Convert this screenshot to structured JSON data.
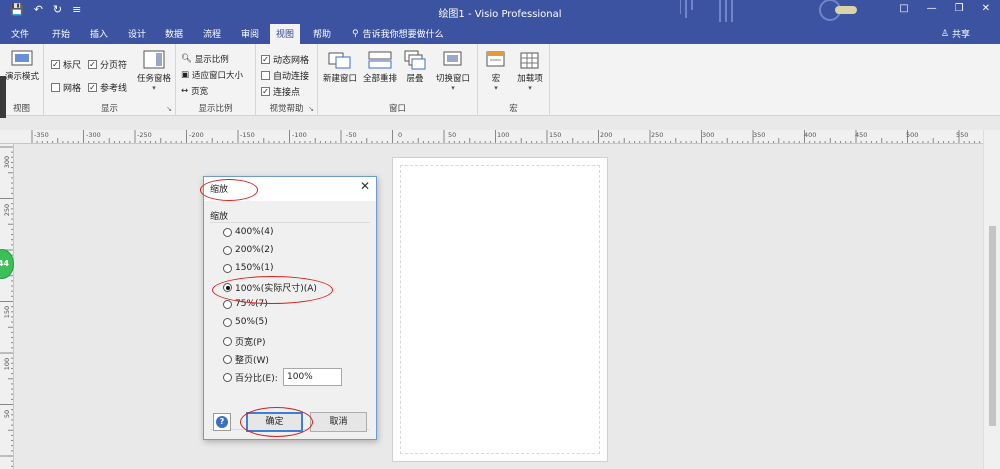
{
  "app": {
    "title": "绘图1 - Visio Professional",
    "menu_tabs": [
      "文件",
      "开始",
      "插入",
      "设计",
      "数据",
      "流程",
      "审阅",
      "视图",
      "帮助"
    ],
    "active_tab": "视图",
    "tell_me": "告诉我你想要做什么",
    "share": "共享"
  },
  "ribbon": {
    "view_group": {
      "button": "演示模式",
      "label": "视图"
    },
    "show_group": {
      "label": "显示",
      "ruler": "标尺",
      "page_breaks": "分页符",
      "grid": "网格",
      "guides": "参考线",
      "task_panes": "任务窗格"
    },
    "zoom_group": {
      "label": "显示比例",
      "zoom": "显示比例",
      "fit_to_window": "适应窗口大小",
      "page_width": "页宽"
    },
    "visual_aids_group": {
      "label": "视觉帮助",
      "dynamic_grid": "动态网格",
      "autoconnect": "自动连接",
      "connection_points": "连接点"
    },
    "window_group": {
      "label": "窗口",
      "new_window": "新建窗口",
      "arrange_all": "全部重排",
      "cascade": "层叠",
      "switch_windows": "切换窗口"
    },
    "macros_group": {
      "label": "宏",
      "macros": "宏",
      "addins": "加载项"
    }
  },
  "rulers": {
    "horizontal": [
      "-350",
      "-300",
      "-250",
      "-200",
      "-150",
      "-100",
      "-50",
      "0",
      "50",
      "100",
      "150",
      "200",
      "250",
      "300",
      "350",
      "400",
      "450",
      "500",
      "550"
    ],
    "vertical": [
      "300",
      "250",
      "200",
      "150",
      "100",
      "50"
    ]
  },
  "side_badge": "44",
  "dialog": {
    "title": "缩放",
    "section": "缩放",
    "options": [
      {
        "label": "400%(4)",
        "selected": false
      },
      {
        "label": "200%(2)",
        "selected": false
      },
      {
        "label": "150%(1)",
        "selected": false
      },
      {
        "label": "100%(实际尺寸)(A)",
        "selected": true
      },
      {
        "label": "75%(7)",
        "selected": false
      },
      {
        "label": "50%(5)",
        "selected": false
      },
      {
        "label": "页宽(P)",
        "selected": false
      },
      {
        "label": "整页(W)",
        "selected": false
      },
      {
        "label": "百分比(E):",
        "selected": false
      }
    ],
    "percent_value": "100%",
    "ok": "确定",
    "cancel": "取消",
    "help": "?"
  },
  "colors": {
    "title_bar": "#3b53a1",
    "annotation": "#d82020",
    "accent": "#3c7fd3"
  }
}
